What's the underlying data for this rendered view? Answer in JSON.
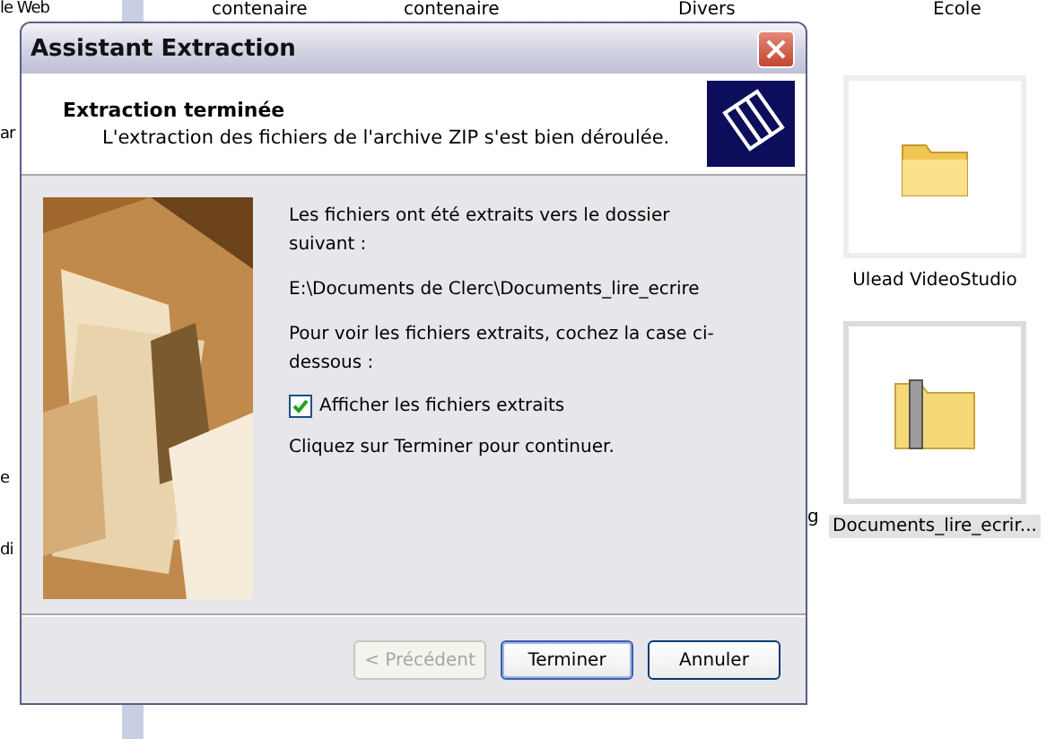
{
  "desktop": {
    "sidebar_items": [
      "le Web",
      "ar",
      "e",
      "di"
    ],
    "top_labels": [
      "contenaire",
      "contenaire",
      "Divers",
      "Ecole"
    ],
    "items": [
      {
        "label": "Ulead VideoStudio",
        "kind": "folder",
        "selected": false
      },
      {
        "label": "Documents_lire_ecrir...",
        "kind": "zip",
        "selected": true
      }
    ],
    "partial_label": "g"
  },
  "dialog": {
    "title": "Assistant Extraction",
    "heading": "Extraction terminée",
    "subheading": "L'extraction des fichiers de l'archive ZIP s'est bien déroulée.",
    "intro": "Les fichiers ont été extraits vers le dossier suivant :",
    "path": "E:\\Documents de Clerc\\Documents_lire_ecrire",
    "hint": "Pour voir les fichiers extraits, cochez la case ci-dessous :",
    "checkbox": {
      "label": "Afficher les fichiers extraits",
      "checked": true
    },
    "outro": "Cliquez sur Terminer pour continuer.",
    "buttons": [
      {
        "label": "< Précédent",
        "disabled": true,
        "default": false
      },
      {
        "label": "Terminer",
        "disabled": false,
        "default": true
      },
      {
        "label": "Annuler",
        "disabled": false,
        "default": false
      }
    ]
  }
}
